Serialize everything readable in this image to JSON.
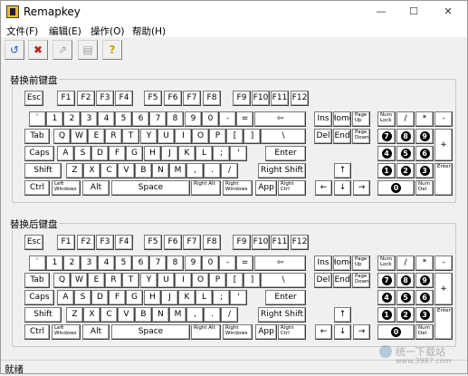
{
  "window": {
    "title": "Remapkey",
    "min": "—",
    "max": "☐",
    "close": "✕"
  },
  "menu": [
    "文件(F)",
    "编辑(E)",
    "操作(O)",
    "帮助(H)"
  ],
  "toolbar": [
    {
      "icon": "open-keyboard-icon",
      "glyph": "↺"
    },
    {
      "icon": "reset-keyboard-icon",
      "glyph": "✖"
    },
    {
      "icon": "save-keyboard-icon",
      "glyph": "⇗"
    },
    {
      "icon": "layout-icon",
      "glyph": "▤"
    },
    {
      "icon": "help-icon",
      "glyph": "?"
    }
  ],
  "groups": {
    "before": "替换前键盘",
    "after": "替换后键盘"
  },
  "keys": {
    "esc": "Esc",
    "f": [
      "F1",
      "F2",
      "F3",
      "F4",
      "F5",
      "F6",
      "F7",
      "F8",
      "F9",
      "F10",
      "F11",
      "F12"
    ],
    "row1": [
      "`",
      "1",
      "2",
      "3",
      "4",
      "5",
      "6",
      "7",
      "8",
      "9",
      "0",
      "-",
      "=",
      "⇦"
    ],
    "row2": [
      "Tab",
      "Q",
      "W",
      "E",
      "R",
      "T",
      "Y",
      "U",
      "I",
      "O",
      "P",
      "[",
      "]",
      "\\"
    ],
    "row3": [
      "Caps",
      "A",
      "S",
      "D",
      "F",
      "G",
      "H",
      "J",
      "K",
      "L",
      ";",
      "'",
      "Enter"
    ],
    "row4": [
      "Shift",
      "Z",
      "X",
      "C",
      "V",
      "B",
      "N",
      "M",
      ",",
      ".",
      "/",
      "Right Shift"
    ],
    "row5": [
      "Ctrl",
      "Left Windows",
      "Alt",
      "Space",
      "Right Alt",
      "Right Windows",
      "App",
      "Right Ctrl"
    ],
    "nav": [
      "Ins",
      "Home",
      "Page Up",
      "Del",
      "End",
      "Page Down"
    ],
    "arrows": [
      "↑",
      "←",
      "↓",
      "→"
    ],
    "numpad": {
      "numlock": "Num Lock",
      "slash": "/",
      "star": "*",
      "minus": "-",
      "plus": "+",
      "enter": "Enter",
      "del": "Num Del",
      "digits": [
        "7",
        "8",
        "9",
        "4",
        "5",
        "6",
        "1",
        "2",
        "3",
        "0"
      ]
    }
  },
  "status": "就绪",
  "watermark": {
    "text": "统一下载站",
    "url": "www.3987.com"
  }
}
